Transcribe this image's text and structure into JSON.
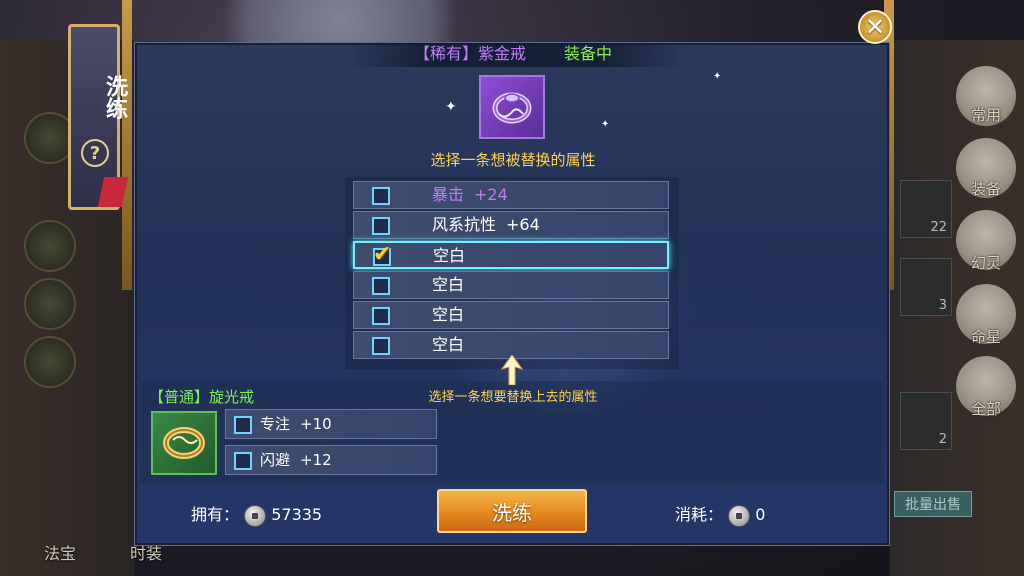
{
  "item": {
    "title": "【稀有】紫金戒",
    "status": "装备中",
    "icon": "purple-ring-icon"
  },
  "prompt_top": "选择一条想被替换的属性",
  "attributes": [
    {
      "name": "暴击",
      "value": "+24",
      "checked": false,
      "color": "#c27cf2"
    },
    {
      "name": "风系抗性",
      "value": "+64",
      "checked": false,
      "color": "#ffffff"
    },
    {
      "name": "空白",
      "value": "",
      "checked": true,
      "color": "#ffffff"
    },
    {
      "name": "空白",
      "value": "",
      "checked": false,
      "color": "#ffffff"
    },
    {
      "name": "空白",
      "value": "",
      "checked": false,
      "color": "#ffffff"
    },
    {
      "name": "空白",
      "value": "",
      "checked": false,
      "color": "#ffffff"
    }
  ],
  "prompt_bottom": "选择一条想要替换上去的属性",
  "source_item": {
    "title": "【普通】旋光戒",
    "icon": "gold-ring-icon",
    "attributes": [
      {
        "name": "专注",
        "value": "+10",
        "checked": false
      },
      {
        "name": "闪避",
        "value": "+12",
        "checked": false
      }
    ]
  },
  "footer": {
    "own_label": "拥有：",
    "own_value": "57335",
    "refine_button": "洗练",
    "cost_label": "消耗：",
    "cost_value": "0"
  },
  "side_tab": {
    "title": "洗练",
    "help": "?"
  },
  "close_button": "✕",
  "background": {
    "right_labels": [
      "常用",
      "装备",
      "幻灵",
      "命星",
      "全部"
    ],
    "bottom_labels": [
      "法宝",
      "时装"
    ],
    "batch_sell": "批量出售",
    "slot_counts": [
      "22",
      "3",
      "2"
    ]
  },
  "colors": {
    "rare_purple": "#c27cf2",
    "equipped_green": "#89f04a",
    "prompt_yellow": "#ffd24c",
    "common_green": "#7ef05a",
    "highlight_cyan": "#6ff0ff"
  }
}
